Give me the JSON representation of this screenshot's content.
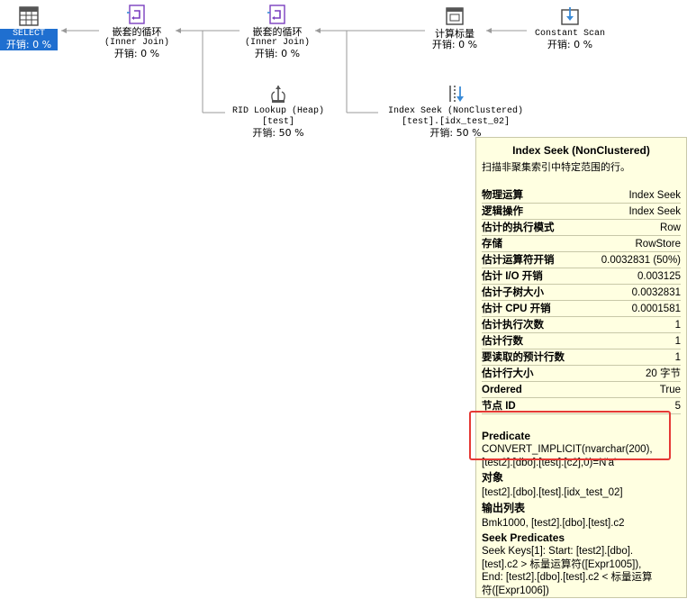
{
  "nodes": {
    "select": {
      "label": "SELECT",
      "cost": "开销: 0 %"
    },
    "nested1": {
      "title": "嵌套的循环",
      "sub": "(Inner Join)",
      "cost": "开销: 0 %"
    },
    "nested2": {
      "title": "嵌套的循环",
      "sub": "(Inner Join)",
      "cost": "开销: 0 %"
    },
    "compute": {
      "title": "计算标量",
      "cost": "开销: 0 %"
    },
    "constant": {
      "title": "Constant Scan",
      "cost": "开销: 0 %"
    },
    "rid": {
      "title": "RID Lookup (Heap)",
      "sub": "[test]",
      "cost": "开销: 50 %"
    },
    "seek": {
      "title": "Index Seek (NonClustered)",
      "sub": "[test].[idx_test_02]",
      "cost": "开销: 50 %"
    }
  },
  "tooltip": {
    "title": "Index Seek (NonClustered)",
    "desc": "扫描非聚集索引中特定范围的行。",
    "rows": [
      {
        "k": "物理运算",
        "v": "Index Seek"
      },
      {
        "k": "逻辑操作",
        "v": "Index Seek"
      },
      {
        "k": "估计的执行模式",
        "v": "Row"
      },
      {
        "k": "存储",
        "v": "RowStore"
      },
      {
        "k": "估计运算符开销",
        "v": "0.0032831 (50%)"
      },
      {
        "k": "估计 I/O 开销",
        "v": "0.003125"
      },
      {
        "k": "估计子树大小",
        "v": "0.0032831"
      },
      {
        "k": "估计 CPU 开销",
        "v": "0.0001581"
      },
      {
        "k": "估计执行次数",
        "v": "1"
      },
      {
        "k": "估计行数",
        "v": "1"
      },
      {
        "k": "要读取的预计行数",
        "v": "1"
      },
      {
        "k": "估计行大小",
        "v": "20 字节"
      },
      {
        "k": "Ordered",
        "v": "True"
      },
      {
        "k": "节点 ID",
        "v": "5"
      }
    ],
    "predicate": {
      "h": "Predicate",
      "l1": "CONVERT_IMPLICIT(nvarchar(200),",
      "l2": "[test2].[dbo].[test].[c2],0)=N'a'"
    },
    "object": {
      "h": "对象",
      "v": "[test2].[dbo].[test].[idx_test_02]"
    },
    "output": {
      "h": "输出列表",
      "v": "Bmk1000, [test2].[dbo].[test].c2"
    },
    "seekpred": {
      "h": "Seek Predicates",
      "l1": "Seek Keys[1]: Start: [test2].[dbo].",
      "l2": "[test].c2 > 标量运算符([Expr1005]),",
      "l3": "End: [test2].[dbo].[test].c2 < 标量运算",
      "l4": "符([Expr1006])"
    }
  }
}
